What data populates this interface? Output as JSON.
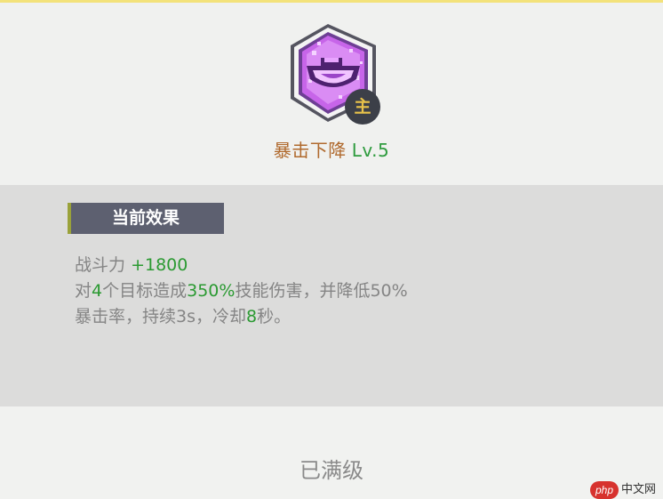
{
  "skill": {
    "name": "暴击下降",
    "level": "Lv.5",
    "badge": "主",
    "icon": "purple-gem-smile-icon"
  },
  "effect": {
    "header": "当前效果",
    "power_label": "战斗力",
    "power_value": "+1800",
    "desc": {
      "p1": "对",
      "targets": "4",
      "p2": "个目标造成",
      "damage": "350%",
      "p3": "技能伤害，并降低50%",
      "p4": "暴击率，持续3s，冷却",
      "cooldown": "8",
      "p5": "秒。"
    }
  },
  "status": {
    "max_level": "已满级"
  },
  "watermark": {
    "badge": "php",
    "text": "中文网"
  },
  "colors": {
    "name": "#b06a2e",
    "level": "#2f9c3f",
    "highlight": "#2b9a32",
    "header_bg": "#5d6070",
    "accent": "#9aa23a",
    "top_line": "#f3e27a"
  }
}
